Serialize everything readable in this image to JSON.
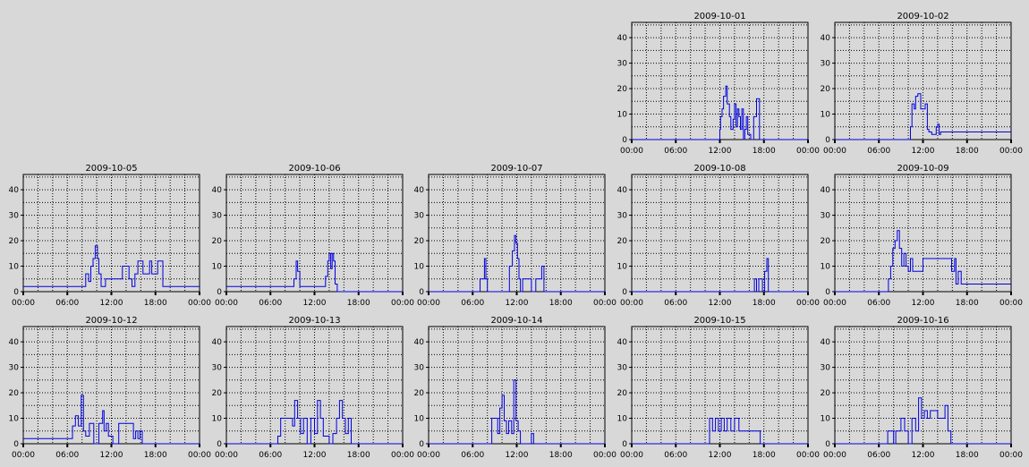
{
  "chart_data": [
    {
      "type": "line",
      "title": "2009-10-01",
      "xticks": [
        "00:00",
        "06:00",
        "12:00",
        "18:00",
        "00:00"
      ],
      "yticks": [
        0,
        10,
        20,
        30,
        40
      ],
      "xlim": [
        0,
        24
      ],
      "ylim": [
        0,
        46
      ],
      "grid": true,
      "color": "#0000e0",
      "x": [
        0,
        12.0,
        12.0,
        12.1,
        12.1,
        12.3,
        12.3,
        12.5,
        12.5,
        12.8,
        12.8,
        13.0,
        13.0,
        13.3,
        13.3,
        13.5,
        13.5,
        13.8,
        13.8,
        14.0,
        14.0,
        14.2,
        14.2,
        14.4,
        14.4,
        14.6,
        14.6,
        14.8,
        14.8,
        15.0,
        15.0,
        15.2,
        15.2,
        15.4,
        15.4,
        15.6,
        15.6,
        15.8,
        15.8,
        16.2,
        16.2,
        16.6,
        16.6,
        17.0,
        17.0,
        17.4,
        17.4,
        24
      ],
      "y": [
        0,
        0,
        4,
        4,
        9,
        9,
        12,
        12,
        17,
        17,
        21,
        21,
        14,
        14,
        9,
        9,
        4,
        4,
        8,
        8,
        14,
        14,
        5,
        5,
        12,
        12,
        9,
        9,
        4,
        4,
        12,
        12,
        0,
        0,
        4,
        4,
        9,
        9,
        2,
        2,
        0,
        0,
        9,
        9,
        16,
        16,
        0,
        0
      ]
    },
    {
      "type": "line",
      "title": "2009-10-02",
      "xticks": [
        "00:00",
        "06:00",
        "12:00",
        "18:00",
        "00:00"
      ],
      "yticks": [
        0,
        10,
        20,
        30,
        40
      ],
      "xlim": [
        0,
        24
      ],
      "ylim": [
        0,
        46
      ],
      "grid": true,
      "color": "#0000e0",
      "x": [
        0,
        10.3,
        10.3,
        10.5,
        10.5,
        10.8,
        10.8,
        11.0,
        11.0,
        11.3,
        11.3,
        11.7,
        11.7,
        12.3,
        12.3,
        12.6,
        12.6,
        12.8,
        12.8,
        13.2,
        13.2,
        13.8,
        13.8,
        14.0,
        14.0,
        14.2,
        14.2,
        14.4,
        14.4,
        24
      ],
      "y": [
        0,
        0,
        5,
        5,
        14,
        14,
        12,
        12,
        17,
        17,
        18,
        18,
        12,
        12,
        14,
        14,
        4,
        4,
        3,
        3,
        2,
        2,
        5,
        5,
        6,
        6,
        2,
        2,
        3,
        3
      ]
    },
    {
      "type": "line",
      "title": "2009-10-05",
      "xticks": [
        "00:00",
        "06:00",
        "12:00",
        "18:00",
        "00:00"
      ],
      "yticks": [
        0,
        10,
        20,
        30,
        40
      ],
      "xlim": [
        0,
        24
      ],
      "ylim": [
        0,
        46
      ],
      "grid": true,
      "color": "#0000e0",
      "x": [
        0,
        8.5,
        8.5,
        8.9,
        8.9,
        9.2,
        9.2,
        9.5,
        9.5,
        9.8,
        9.8,
        10.1,
        10.1,
        10.3,
        10.3,
        10.6,
        10.6,
        11.2,
        11.2,
        13.5,
        13.5,
        14.4,
        14.4,
        14.8,
        14.8,
        15.2,
        15.2,
        15.6,
        15.6,
        16.3,
        16.3,
        17.2,
        17.2,
        17.5,
        17.5,
        18.3,
        18.3,
        19.0,
        19.0,
        19.3,
        19.3,
        24
      ],
      "y": [
        2,
        2,
        7,
        7,
        4,
        4,
        10,
        10,
        13,
        13,
        18,
        18,
        13,
        13,
        7,
        7,
        2,
        2,
        5,
        5,
        10,
        10,
        5,
        5,
        2,
        2,
        7,
        7,
        12,
        12,
        7,
        7,
        12,
        12,
        7,
        7,
        12,
        12,
        2,
        2,
        2,
        2
      ]
    },
    {
      "type": "line",
      "title": "2009-10-06",
      "xticks": [
        "00:00",
        "06:00",
        "12:00",
        "18:00",
        "00:00"
      ],
      "yticks": [
        0,
        10,
        20,
        30,
        40
      ],
      "xlim": [
        0,
        24
      ],
      "ylim": [
        0,
        46
      ],
      "grid": true,
      "color": "#0000e0",
      "x": [
        0,
        9.2,
        9.2,
        9.5,
        9.5,
        9.7,
        9.7,
        10.0,
        10.0,
        10.2,
        10.2,
        13.5,
        13.5,
        13.8,
        13.8,
        14.0,
        14.0,
        14.2,
        14.2,
        14.4,
        14.4,
        14.6,
        14.6,
        14.8,
        14.8,
        15.1,
        15.1,
        24
      ],
      "y": [
        2,
        2,
        5,
        5,
        12,
        12,
        8,
        8,
        2,
        2,
        2,
        2,
        6,
        6,
        12,
        12,
        15,
        15,
        9,
        9,
        15,
        15,
        12,
        12,
        3,
        3,
        0,
        0
      ]
    },
    {
      "type": "line",
      "title": "2009-10-07",
      "xticks": [
        "00:00",
        "06:00",
        "12:00",
        "18:00",
        "00:00"
      ],
      "yticks": [
        0,
        10,
        20,
        30,
        40
      ],
      "xlim": [
        0,
        24
      ],
      "ylim": [
        0,
        46
      ],
      "grid": true,
      "color": "#0000e0",
      "x": [
        0,
        7.0,
        7.0,
        7.6,
        7.6,
        7.8,
        7.8,
        8.0,
        8.0,
        9.0,
        9.0,
        11.0,
        11.0,
        11.4,
        11.4,
        11.7,
        11.7,
        11.9,
        11.9,
        12.1,
        12.1,
        12.3,
        12.3,
        12.5,
        12.5,
        12.8,
        12.8,
        14.0,
        14.0,
        14.6,
        14.6,
        15.4,
        15.4,
        15.7,
        15.7,
        24
      ],
      "y": [
        0,
        0,
        5,
        5,
        13,
        13,
        5,
        5,
        0,
        0,
        0,
        0,
        10,
        10,
        16,
        16,
        22,
        22,
        19,
        19,
        13,
        13,
        5,
        5,
        0,
        0,
        5,
        5,
        0,
        0,
        5,
        5,
        10,
        10,
        0,
        0
      ]
    },
    {
      "type": "line",
      "title": "2009-10-08",
      "xticks": [
        "00:00",
        "06:00",
        "12:00",
        "18:00",
        "00:00"
      ],
      "yticks": [
        0,
        10,
        20,
        30,
        40
      ],
      "xlim": [
        0,
        24
      ],
      "ylim": [
        0,
        46
      ],
      "grid": true,
      "color": "#0000e0",
      "x": [
        0,
        16.7,
        16.7,
        17.0,
        17.0,
        17.3,
        17.3,
        17.8,
        17.8,
        18.1,
        18.1,
        18.4,
        18.4,
        18.6,
        18.6,
        18.9,
        18.9,
        24
      ],
      "y": [
        0,
        0,
        5,
        5,
        0,
        0,
        5,
        5,
        0,
        0,
        8,
        8,
        13,
        13,
        0,
        0,
        0,
        0
      ]
    },
    {
      "type": "line",
      "title": "2009-10-09",
      "xticks": [
        "00:00",
        "06:00",
        "12:00",
        "18:00",
        "00:00"
      ],
      "yticks": [
        0,
        10,
        20,
        30,
        40
      ],
      "xlim": [
        0,
        24
      ],
      "ylim": [
        0,
        46
      ],
      "grid": true,
      "color": "#0000e0",
      "x": [
        0,
        7.3,
        7.3,
        7.6,
        7.6,
        7.9,
        7.9,
        8.2,
        8.2,
        8.5,
        8.5,
        8.8,
        8.8,
        9.1,
        9.1,
        9.4,
        9.4,
        9.7,
        9.7,
        10.0,
        10.0,
        10.3,
        10.3,
        10.6,
        10.6,
        10.9,
        10.9,
        11.2,
        11.2,
        12.0,
        12.0,
        15.9,
        15.9,
        16.3,
        16.3,
        16.5,
        16.5,
        16.8,
        16.8,
        17.2,
        17.2,
        24
      ],
      "y": [
        0,
        0,
        5,
        5,
        10,
        10,
        17,
        17,
        20,
        20,
        24,
        24,
        17,
        17,
        10,
        10,
        15,
        15,
        10,
        10,
        8,
        8,
        13,
        13,
        8,
        8,
        8,
        8,
        8,
        8,
        13,
        13,
        8,
        8,
        13,
        13,
        3,
        3,
        8,
        8,
        3,
        3
      ]
    },
    {
      "type": "line",
      "title": "2009-10-12",
      "xticks": [
        "00:00",
        "06:00",
        "12:00",
        "18:00",
        "00:00"
      ],
      "yticks": [
        0,
        10,
        20,
        30,
        40
      ],
      "xlim": [
        0,
        24
      ],
      "ylim": [
        0,
        46
      ],
      "grid": true,
      "color": "#0000e0",
      "x": [
        0,
        6.7,
        6.7,
        7.1,
        7.1,
        7.5,
        7.5,
        7.9,
        7.9,
        8.2,
        8.2,
        8.5,
        8.5,
        9.0,
        9.0,
        9.6,
        9.6,
        10.3,
        10.3,
        10.8,
        10.8,
        11.0,
        11.0,
        11.3,
        11.3,
        11.6,
        11.6,
        12.2,
        12.2,
        13.0,
        13.0,
        15.0,
        15.0,
        15.3,
        15.3,
        15.6,
        15.6,
        15.9,
        15.9,
        16.2,
        16.2,
        16.8,
        16.8,
        24
      ],
      "y": [
        2,
        2,
        7,
        7,
        11,
        11,
        7,
        7,
        19,
        19,
        5,
        5,
        3,
        3,
        8,
        8,
        0,
        0,
        8,
        8,
        13,
        13,
        5,
        5,
        8,
        8,
        3,
        3,
        0,
        0,
        8,
        8,
        2,
        2,
        5,
        5,
        2,
        2,
        5,
        5,
        0,
        0,
        0,
        0
      ]
    },
    {
      "type": "line",
      "title": "2009-10-13",
      "xticks": [
        "00:00",
        "06:00",
        "12:00",
        "18:00",
        "00:00"
      ],
      "yticks": [
        0,
        10,
        20,
        30,
        40
      ],
      "xlim": [
        0,
        24
      ],
      "ylim": [
        0,
        46
      ],
      "grid": true,
      "color": "#0000e0",
      "x": [
        0,
        7.0,
        7.0,
        7.4,
        7.4,
        9.0,
        9.0,
        9.3,
        9.3,
        9.7,
        9.7,
        10.1,
        10.1,
        10.5,
        10.5,
        11.0,
        11.0,
        11.5,
        11.5,
        12.0,
        12.0,
        12.4,
        12.4,
        12.8,
        12.8,
        13.2,
        13.2,
        14.0,
        14.0,
        14.5,
        14.5,
        15.0,
        15.0,
        15.4,
        15.4,
        15.8,
        15.8,
        16.2,
        16.2,
        16.6,
        16.6,
        17.0,
        17.0,
        24
      ],
      "y": [
        0,
        0,
        3,
        3,
        10,
        10,
        7,
        7,
        17,
        17,
        10,
        10,
        4,
        4,
        10,
        10,
        0,
        0,
        10,
        10,
        4,
        4,
        17,
        17,
        10,
        10,
        3,
        3,
        0,
        0,
        4,
        4,
        10,
        10,
        17,
        17,
        10,
        10,
        4,
        4,
        10,
        10,
        0,
        0
      ]
    },
    {
      "type": "line",
      "title": "2009-10-14",
      "xticks": [
        "00:00",
        "06:00",
        "12:00",
        "18:00",
        "00:00"
      ],
      "yticks": [
        0,
        10,
        20,
        30,
        40
      ],
      "xlim": [
        0,
        24
      ],
      "ylim": [
        0,
        46
      ],
      "grid": true,
      "color": "#0000e0",
      "x": [
        0,
        8.6,
        8.6,
        9.4,
        9.4,
        9.7,
        9.7,
        10.0,
        10.0,
        10.3,
        10.3,
        10.6,
        10.6,
        10.9,
        10.9,
        11.3,
        11.3,
        11.6,
        11.6,
        11.9,
        11.9,
        12.2,
        12.2,
        12.5,
        12.5,
        14.0,
        14.0,
        14.3,
        14.3,
        14.6,
        14.6,
        24
      ],
      "y": [
        0,
        0,
        10,
        10,
        4,
        4,
        14,
        14,
        19,
        19,
        9,
        9,
        4,
        4,
        9,
        9,
        4,
        4,
        25,
        25,
        9,
        9,
        5,
        5,
        0,
        0,
        4,
        4,
        0,
        0,
        0,
        0
      ]
    },
    {
      "type": "line",
      "title": "2009-10-15",
      "xticks": [
        "00:00",
        "06:00",
        "12:00",
        "18:00",
        "00:00"
      ],
      "yticks": [
        0,
        10,
        20,
        30,
        40
      ],
      "xlim": [
        0,
        24
      ],
      "ylim": [
        0,
        46
      ],
      "grid": true,
      "color": "#0000e0",
      "x": [
        0,
        10.6,
        10.6,
        11.0,
        11.0,
        11.4,
        11.4,
        11.8,
        11.8,
        12.2,
        12.2,
        12.6,
        12.6,
        13.0,
        13.0,
        13.5,
        13.5,
        14.0,
        14.0,
        14.6,
        14.6,
        15.2,
        15.2,
        16.0,
        16.0,
        17.5,
        17.5,
        24
      ],
      "y": [
        0,
        0,
        10,
        10,
        5,
        5,
        10,
        10,
        5,
        5,
        10,
        10,
        5,
        5,
        10,
        10,
        5,
        5,
        10,
        10,
        5,
        5,
        5,
        5,
        5,
        5,
        0,
        0
      ]
    },
    {
      "type": "line",
      "title": "2009-10-16",
      "xticks": [
        "00:00",
        "06:00",
        "12:00",
        "18:00",
        "00:00"
      ],
      "yticks": [
        0,
        10,
        20,
        30,
        40
      ],
      "xlim": [
        0,
        24
      ],
      "ylim": [
        0,
        46
      ],
      "grid": true,
      "color": "#0000e0",
      "x": [
        0,
        7.2,
        7.2,
        8.0,
        8.0,
        8.3,
        8.3,
        9.0,
        9.0,
        9.5,
        9.5,
        10.0,
        10.0,
        10.5,
        10.5,
        11.0,
        11.0,
        11.4,
        11.4,
        11.8,
        11.8,
        12.2,
        12.2,
        12.6,
        12.6,
        13.0,
        13.0,
        14.0,
        14.0,
        15.0,
        15.0,
        15.4,
        15.4,
        15.8,
        15.8,
        24
      ],
      "y": [
        0,
        0,
        5,
        5,
        0,
        0,
        5,
        5,
        10,
        10,
        5,
        5,
        0,
        0,
        10,
        10,
        5,
        5,
        18,
        18,
        10,
        10,
        13,
        13,
        10,
        10,
        13,
        13,
        10,
        10,
        15,
        15,
        5,
        5,
        0,
        0
      ]
    }
  ]
}
